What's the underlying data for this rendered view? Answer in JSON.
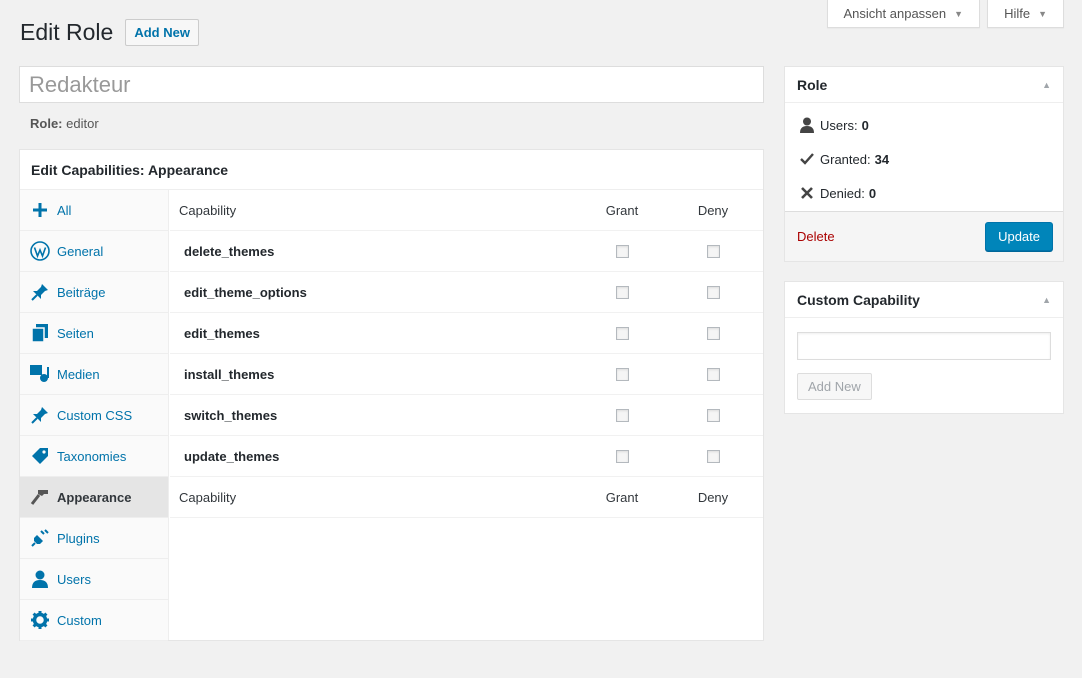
{
  "screen_options": {
    "label": "Ansicht anpassen"
  },
  "help": {
    "label": "Hilfe"
  },
  "header": {
    "title": "Edit Role",
    "add_new": "Add New"
  },
  "role_name": {
    "value": "Redakteur"
  },
  "role_slug": {
    "label": "Role:",
    "value": "editor"
  },
  "capabilities": {
    "title": "Edit Capabilities: Appearance",
    "sidebar": [
      {
        "label": "All",
        "icon": "plus-icon"
      },
      {
        "label": "General",
        "icon": "wordpress-icon"
      },
      {
        "label": "Beiträge",
        "icon": "pin-icon"
      },
      {
        "label": "Seiten",
        "icon": "pages-icon"
      },
      {
        "label": "Medien",
        "icon": "media-icon"
      },
      {
        "label": "Custom CSS",
        "icon": "pin-icon"
      },
      {
        "label": "Taxonomies",
        "icon": "tag-icon"
      },
      {
        "label": "Appearance",
        "icon": "brush-icon",
        "active": true
      },
      {
        "label": "Plugins",
        "icon": "plug-icon"
      },
      {
        "label": "Users",
        "icon": "user-icon"
      },
      {
        "label": "Custom",
        "icon": "gear-icon"
      }
    ],
    "columns": {
      "capability": "Capability",
      "grant": "Grant",
      "deny": "Deny"
    },
    "rows": [
      {
        "name": "delete_themes",
        "grant": false,
        "deny": false
      },
      {
        "name": "edit_theme_options",
        "grant": false,
        "deny": false
      },
      {
        "name": "edit_themes",
        "grant": false,
        "deny": false
      },
      {
        "name": "install_themes",
        "grant": false,
        "deny": false
      },
      {
        "name": "switch_themes",
        "grant": false,
        "deny": false
      },
      {
        "name": "update_themes",
        "grant": false,
        "deny": false
      }
    ]
  },
  "role_box": {
    "title": "Role",
    "users_label": "Users:",
    "users": "0",
    "granted_label": "Granted:",
    "granted": "34",
    "denied_label": "Denied:",
    "denied": "0",
    "delete": "Delete",
    "update": "Update"
  },
  "custom_capability": {
    "title": "Custom Capability",
    "input_value": "",
    "add_new": "Add New"
  },
  "colors": {
    "accent": "#0073aa",
    "button": "#0085ba",
    "delete": "#aa0000"
  }
}
